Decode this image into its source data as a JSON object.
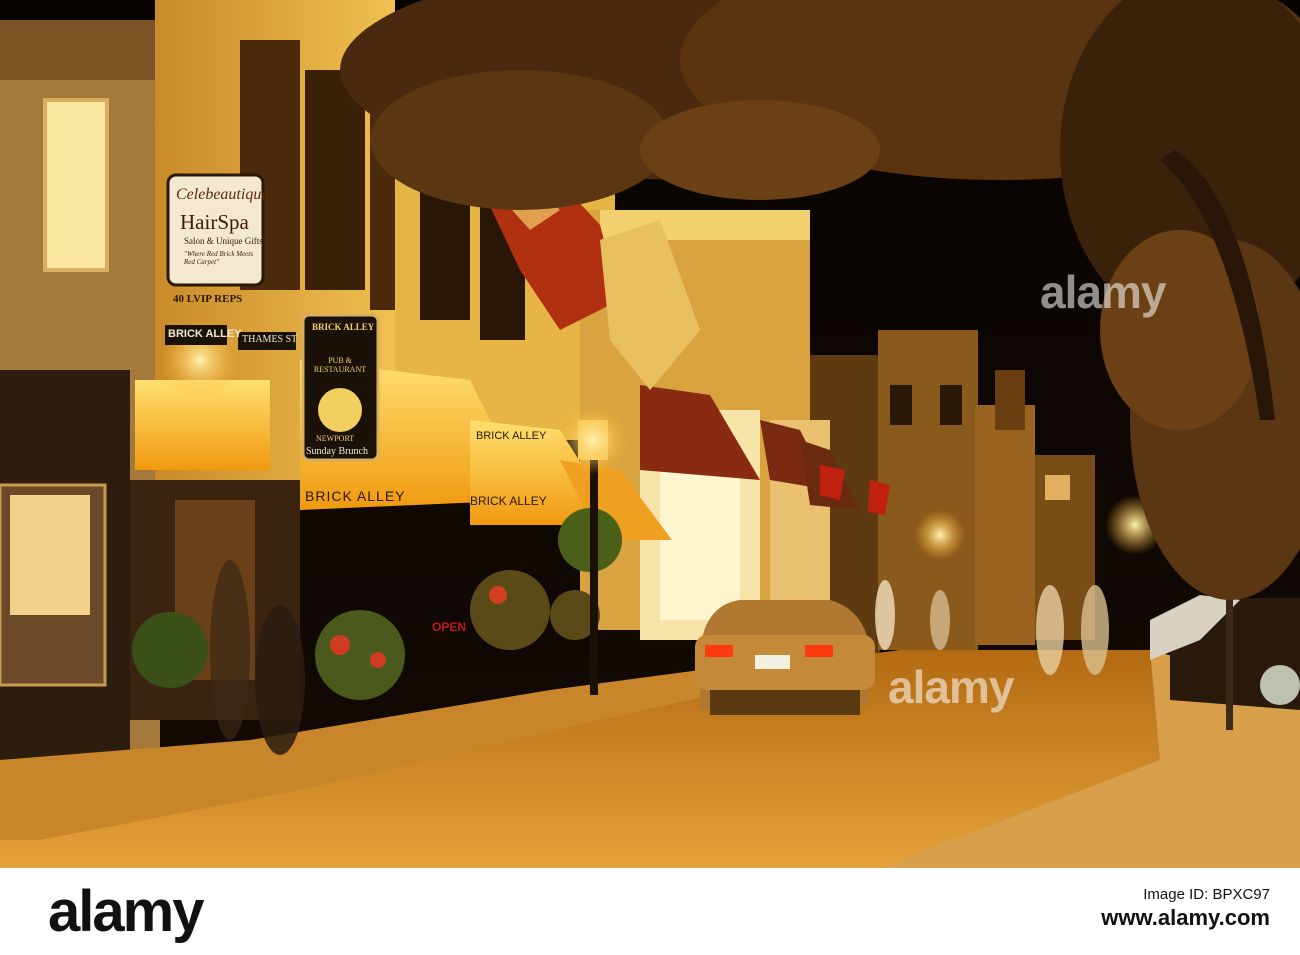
{
  "photo": {
    "signs": {
      "celebeautique": "Celebeautique",
      "hairspa": "HairSpa",
      "salon_gifts": "Salon & Unique Gifts",
      "tagline": "\"Where Red Brick Meets Red Carpet\"",
      "address": "40 LVIP REPS",
      "thames_st": "THAMES ST",
      "brick_alley_street_sign": "BRICK ALLEY",
      "pub_name": "BRICK ALLEY",
      "pub_restaurant": "PUB & RESTAURANT",
      "pub_city": "NEWPORT",
      "sunday_brunch": "Sunday Brunch",
      "awning_main": "BRICK ALLEY",
      "awning_second": "BRICK ALLEY",
      "awning_third": "BRICK ALLEY",
      "open_sign": "OPEN"
    },
    "watermarks": [
      "alamy",
      "alamy",
      "alamy"
    ]
  },
  "footer": {
    "logo": "alamy",
    "image_id_label": "Image ID: BPXC97",
    "site": "www.alamy.com"
  }
}
